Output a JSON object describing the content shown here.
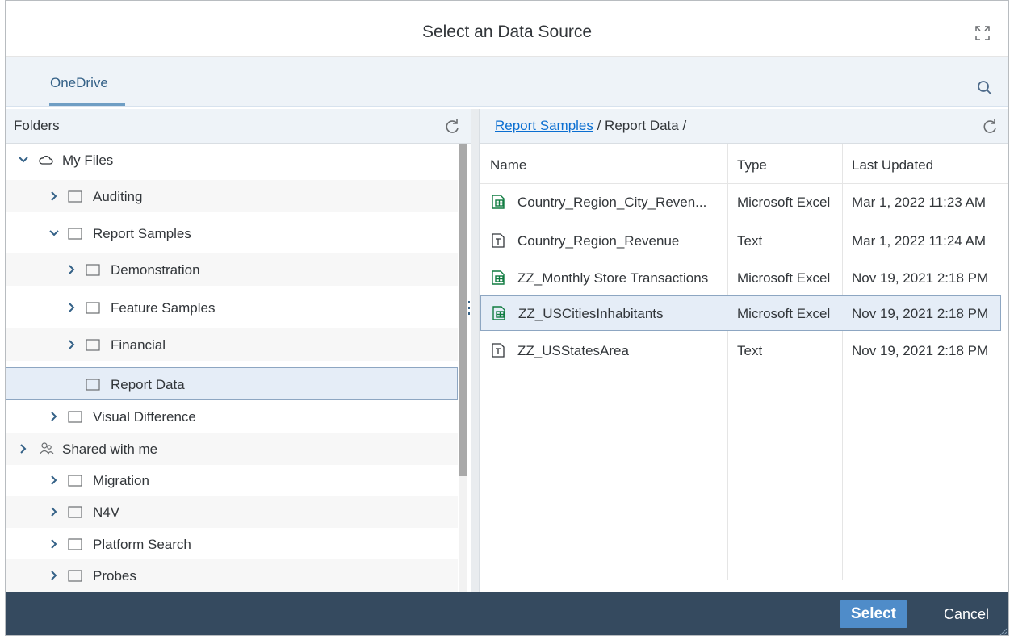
{
  "dialog": {
    "title": "Select an Data Source",
    "maximize_icon": "maximize-icon",
    "tabs": [
      {
        "label": "OneDrive",
        "active": true
      }
    ],
    "search_icon": "search-icon"
  },
  "folders": {
    "header": "Folders",
    "refresh_icon": "refresh-icon",
    "tree": [
      {
        "label": "My Files",
        "level": 0,
        "state": "expanded",
        "icon": "cloud-icon"
      },
      {
        "label": "Auditing",
        "level": 1,
        "state": "collapsed",
        "icon": "folder-icon"
      },
      {
        "label": "Report Samples",
        "level": 1,
        "state": "expanded",
        "icon": "folder-icon"
      },
      {
        "label": "Demonstration",
        "level": 2,
        "state": "collapsed",
        "icon": "folder-icon"
      },
      {
        "label": "Feature Samples",
        "level": 2,
        "state": "collapsed",
        "icon": "folder-icon"
      },
      {
        "label": "Financial",
        "level": 2,
        "state": "collapsed",
        "icon": "folder-icon"
      },
      {
        "label": "Report Data",
        "level": 2,
        "state": "leaf",
        "icon": "folder-icon",
        "selected": true
      },
      {
        "label": "Visual Difference",
        "level": 1,
        "state": "collapsed",
        "icon": "folder-icon"
      },
      {
        "label": "Shared with me",
        "level": 0,
        "state": "collapsed",
        "icon": "shared-users-icon"
      },
      {
        "label": "Migration",
        "level": 1,
        "state": "collapsed",
        "icon": "folder-icon"
      },
      {
        "label": "N4V",
        "level": 1,
        "state": "collapsed",
        "icon": "folder-icon"
      },
      {
        "label": "Platform Search",
        "level": 1,
        "state": "collapsed",
        "icon": "folder-icon"
      },
      {
        "label": "Probes",
        "level": 1,
        "state": "collapsed",
        "icon": "folder-icon"
      }
    ]
  },
  "files": {
    "breadcrumb": {
      "link": "Report Samples",
      "rest": " / Report Data /"
    },
    "refresh_icon": "refresh-icon",
    "columns": {
      "name": "Name",
      "type": "Type",
      "updated": "Last Updated"
    },
    "rows": [
      {
        "name": "Country_Region_City_Reven...",
        "type": "Microsoft Excel",
        "updated": "Mar 1, 2022 11:23 AM",
        "icon": "excel-file-icon"
      },
      {
        "name": "Country_Region_Revenue",
        "type": "Text",
        "updated": "Mar 1, 2022 11:24 AM",
        "icon": "text-file-icon"
      },
      {
        "name": "ZZ_Monthly Store Transactions",
        "type": "Microsoft Excel",
        "updated": "Nov 19, 2021 2:18 PM",
        "icon": "excel-file-icon"
      },
      {
        "name": "ZZ_USCitiesInhabitants",
        "type": "Microsoft Excel",
        "updated": "Nov 19, 2021 2:18 PM",
        "icon": "excel-file-icon",
        "selected": true
      },
      {
        "name": "ZZ_USStatesArea",
        "type": "Text",
        "updated": "Nov 19, 2021 2:18 PM",
        "icon": "text-file-icon"
      }
    ]
  },
  "footer": {
    "select_label": "Select",
    "cancel_label": "Cancel"
  },
  "colors": {
    "link": "#0a6ed1",
    "excel_green": "#107c41",
    "footer_bg": "#354a5f",
    "primary_button": "#4f8cc9",
    "selection_bg": "#e5edf7"
  }
}
